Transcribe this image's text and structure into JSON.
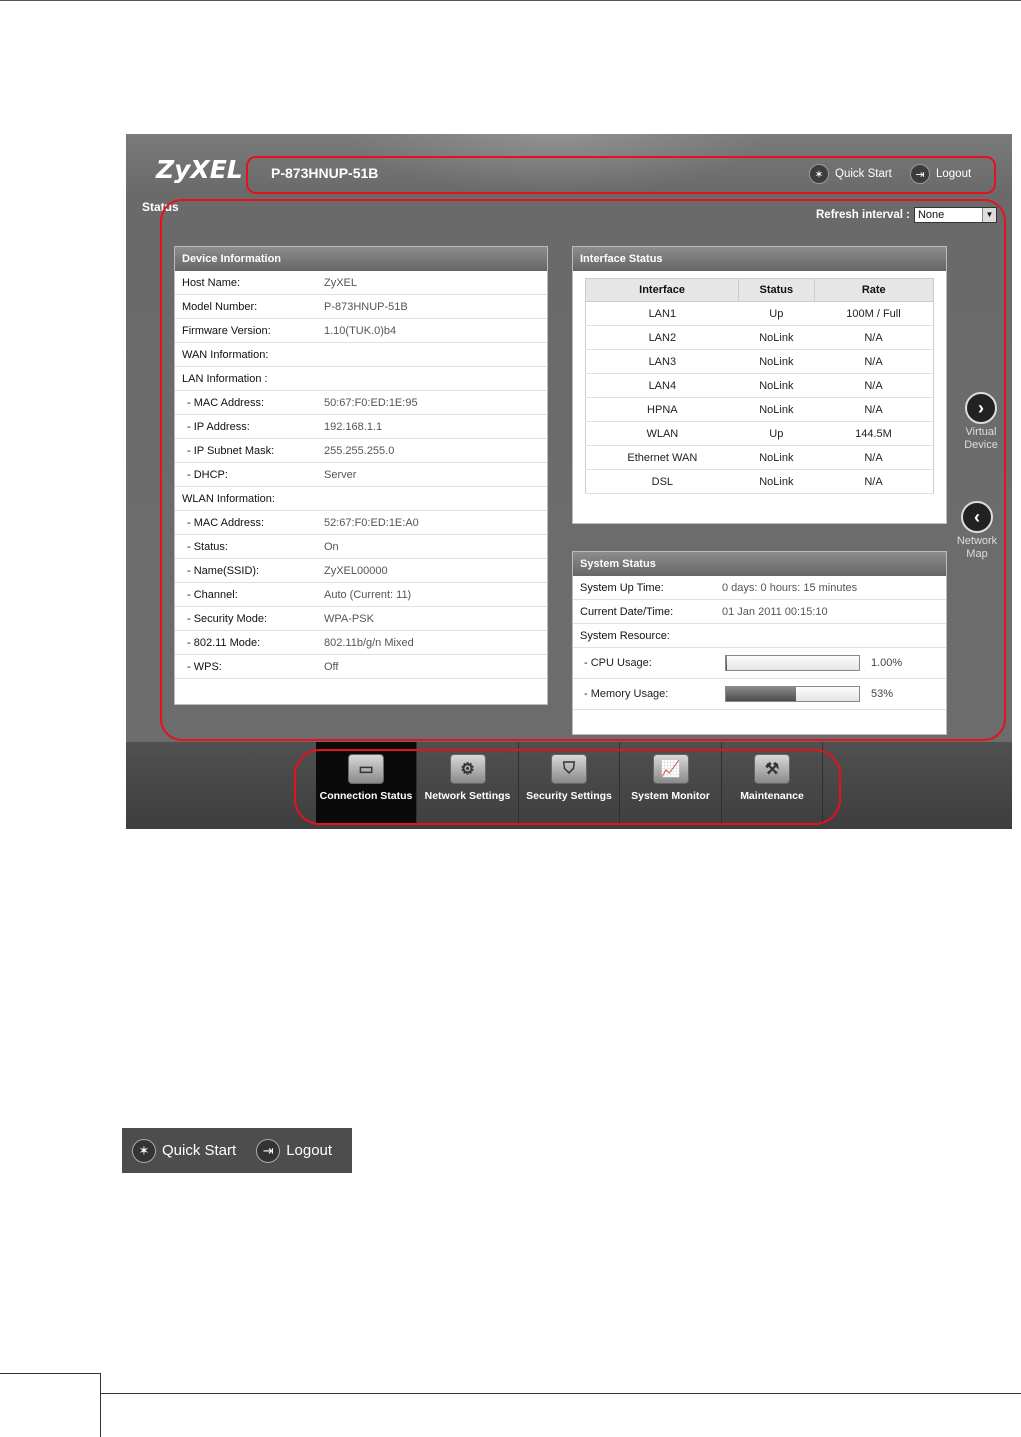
{
  "header": {
    "logo": "ZyXEL",
    "model": "P-873HNUP-51B",
    "quick_start": "Quick Start",
    "logout": "Logout"
  },
  "page": {
    "title": "Status",
    "refresh_label": "Refresh interval :",
    "refresh_value": "None"
  },
  "device_info": {
    "title": "Device Information",
    "rows": [
      {
        "k": "Host Name:",
        "v": "ZyXEL"
      },
      {
        "k": "Model Number:",
        "v": "P-873HNUP-51B"
      },
      {
        "k": "Firmware Version:",
        "v": "1.10(TUK.0)b4"
      },
      {
        "k": "WAN Information:",
        "v": ""
      },
      {
        "k": "LAN Information :",
        "v": ""
      },
      {
        "k": " - MAC Address:",
        "v": "50:67:F0:ED:1E:95"
      },
      {
        "k": " - IP Address:",
        "v": "192.168.1.1"
      },
      {
        "k": " - IP Subnet Mask:",
        "v": "255.255.255.0"
      },
      {
        "k": " - DHCP:",
        "v": "Server"
      },
      {
        "k": "WLAN Information:",
        "v": ""
      },
      {
        "k": " - MAC Address:",
        "v": "52:67:F0:ED:1E:A0"
      },
      {
        "k": " - Status:",
        "v": "On"
      },
      {
        "k": " - Name(SSID):",
        "v": "ZyXEL00000"
      },
      {
        "k": " - Channel:",
        "v": "Auto (Current: 11)"
      },
      {
        "k": " - Security Mode:",
        "v": "WPA-PSK"
      },
      {
        "k": " - 802.11 Mode:",
        "v": "802.11b/g/n Mixed"
      },
      {
        "k": " - WPS:",
        "v": "Off"
      }
    ]
  },
  "interface_status": {
    "title": "Interface Status",
    "headers": [
      "Interface",
      "Status",
      "Rate"
    ],
    "rows": [
      [
        "LAN1",
        "Up",
        "100M / Full"
      ],
      [
        "LAN2",
        "NoLink",
        "N/A"
      ],
      [
        "LAN3",
        "NoLink",
        "N/A"
      ],
      [
        "LAN4",
        "NoLink",
        "N/A"
      ],
      [
        "HPNA",
        "NoLink",
        "N/A"
      ],
      [
        "WLAN",
        "Up",
        "144.5M"
      ],
      [
        "Ethernet WAN",
        "NoLink",
        "N/A"
      ],
      [
        "DSL",
        "NoLink",
        "N/A"
      ]
    ]
  },
  "system_status": {
    "title": "System Status",
    "up_time_label": "System Up Time:",
    "up_time": "0 days: 0 hours: 15 minutes",
    "date_label": "Current Date/Time:",
    "date": "01 Jan 2011 00:15:10",
    "resource_label": "System Resource:",
    "cpu_label": " - CPU Usage:",
    "cpu_text": "1.00%",
    "cpu_fraction": 0.01,
    "mem_label": " - Memory Usage:",
    "mem_text": "53%",
    "mem_fraction": 0.53
  },
  "side": {
    "virtual_line1": "Virtual",
    "virtual_line2": "Device",
    "network_line1": "Network",
    "network_line2": "Map"
  },
  "nav": [
    {
      "label": "Connection Status",
      "icon": "monitor-icon",
      "active": true
    },
    {
      "label": "Network Settings",
      "icon": "gear-icon",
      "active": false
    },
    {
      "label": "Security Settings",
      "icon": "shield-icon",
      "active": false
    },
    {
      "label": "System Monitor",
      "icon": "chart-icon",
      "active": false
    },
    {
      "label": "Maintenance",
      "icon": "tools-icon",
      "active": false
    }
  ],
  "inset": {
    "quick_start": "Quick Start",
    "logout": "Logout"
  },
  "colors": {
    "highlight": "#e8101a"
  }
}
